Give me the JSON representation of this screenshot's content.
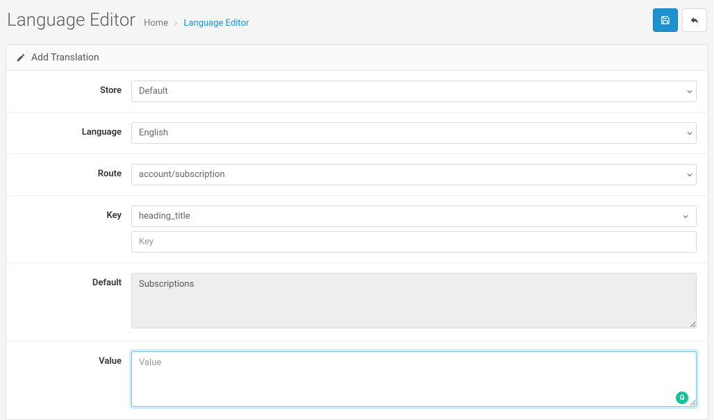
{
  "header": {
    "title": "Language Editor",
    "breadcrumb_home": "Home",
    "breadcrumb_current": "Language Editor"
  },
  "toolbar": {
    "save_label": "Save",
    "back_label": "Back"
  },
  "panel": {
    "heading": "Add Translation"
  },
  "form": {
    "store": {
      "label": "Store",
      "value": "Default"
    },
    "language": {
      "label": "Language",
      "value": "English"
    },
    "route": {
      "label": "Route",
      "value": "account/subscription"
    },
    "key": {
      "label": "Key",
      "value": "heading_title",
      "placeholder": "Key"
    },
    "default": {
      "label": "Default",
      "value": "Subscriptions"
    },
    "value": {
      "label": "Value",
      "value": "",
      "placeholder": "Value"
    }
  }
}
